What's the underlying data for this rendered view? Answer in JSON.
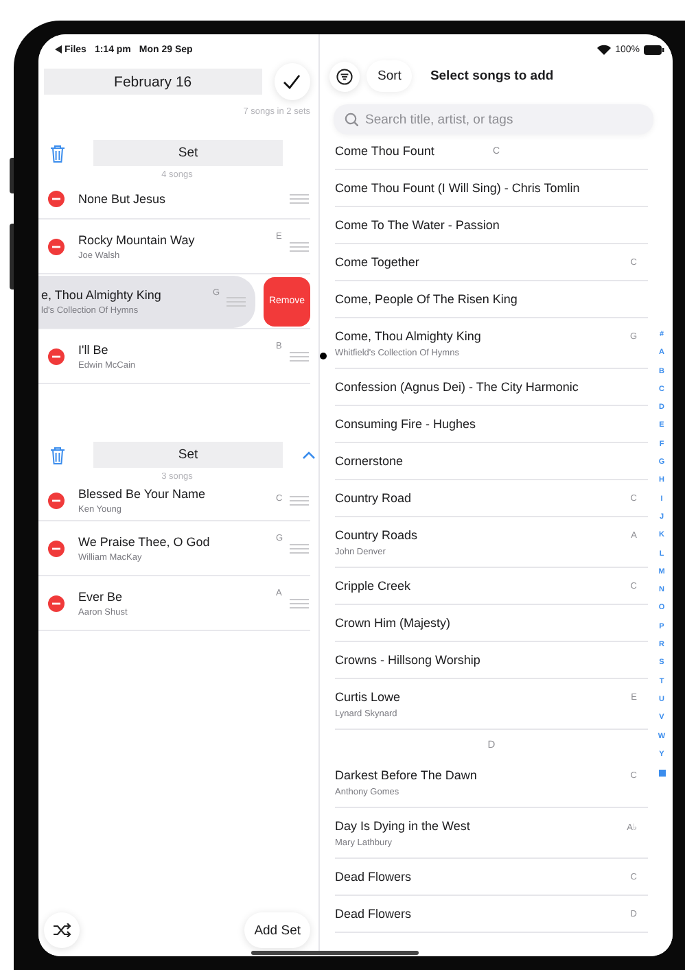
{
  "left_status": {
    "back_label": "Files",
    "time": "1:14 pm",
    "date": "Mon 29 Sep"
  },
  "setlist": {
    "title": "February 16",
    "summary": "7 songs in 2 sets"
  },
  "sets": [
    {
      "name": "Set",
      "count": "4 songs",
      "collapse_button": false,
      "songs": [
        {
          "title": "None But Jesus",
          "swiped": false
        },
        {
          "title": "Rocky Mountain Way",
          "artist": "Joe Walsh",
          "key": "E",
          "swiped": false
        },
        {
          "title": "e, Thou Almighty King",
          "artist": "ld's Collection Of Hymns",
          "key": "G",
          "swiped": true,
          "swipe_action": "Remove"
        },
        {
          "title": "I'll Be",
          "artist": "Edwin McCain",
          "key": "B",
          "swiped": false
        }
      ]
    },
    {
      "name": "Set",
      "count": "3 songs",
      "collapse_button": true,
      "songs": [
        {
          "title": "Blessed Be Your Name",
          "artist": "Ken Young",
          "key": "C",
          "swiped": false
        },
        {
          "title": "We Praise Thee, O God",
          "artist": "William MacKay",
          "key": "G",
          "swiped": false
        },
        {
          "title": "Ever Be",
          "artist": "Aaron Shust",
          "key": "A",
          "swiped": false
        }
      ]
    }
  ],
  "add_set_label": "Add Set",
  "right_status": {
    "battery": "100%"
  },
  "toolbar": {
    "sort_label": "Sort",
    "title": "Select songs to add"
  },
  "search": {
    "placeholder": "Search title, artist, or tags"
  },
  "library": [
    {
      "kind": "song",
      "title": "Come Thou Fount"
    },
    {
      "kind": "sticky_section",
      "label": "C"
    },
    {
      "kind": "song",
      "title": "Come Thou Fount (I Will Sing) - Chris Tomlin"
    },
    {
      "kind": "song",
      "title": "Come To The Water - Passion"
    },
    {
      "kind": "song",
      "title": "Come Together",
      "key": "C"
    },
    {
      "kind": "song",
      "title": "Come, People Of The Risen King"
    },
    {
      "kind": "song",
      "title": "Come, Thou Almighty King",
      "artist": "Whitfield's Collection Of Hymns",
      "key": "G"
    },
    {
      "kind": "song",
      "title": "Confession (Agnus Dei) - The City Harmonic"
    },
    {
      "kind": "song",
      "title": "Consuming Fire - Hughes"
    },
    {
      "kind": "song",
      "title": "Cornerstone"
    },
    {
      "kind": "song",
      "title": "Country Road",
      "key": "C"
    },
    {
      "kind": "song",
      "title": "Country Roads",
      "artist": "John Denver",
      "key": "A"
    },
    {
      "kind": "song",
      "title": "Cripple Creek",
      "key": "C"
    },
    {
      "kind": "song",
      "title": "Crown Him (Majesty)"
    },
    {
      "kind": "song",
      "title": "Crowns - Hillsong Worship"
    },
    {
      "kind": "song",
      "title": "Curtis Lowe",
      "artist": "Lynard Skynard",
      "key": "E"
    },
    {
      "kind": "section",
      "label": "D"
    },
    {
      "kind": "song",
      "title": "Darkest Before The Dawn",
      "artist": "Anthony Gomes",
      "key": "C"
    },
    {
      "kind": "song",
      "title": "Day Is Dying in the West",
      "artist": "Mary Lathbury",
      "key": "A♭"
    },
    {
      "kind": "song",
      "title": "Dead Flowers",
      "key": "C"
    },
    {
      "kind": "song",
      "title": "Dead Flowers",
      "key": "D"
    }
  ],
  "index_letters": [
    "#",
    "A",
    "B",
    "C",
    "D",
    "E",
    "F",
    "G",
    "H",
    "I",
    "J",
    "K",
    "L",
    "M",
    "N",
    "O",
    "P",
    "R",
    "S",
    "T",
    "U",
    "V",
    "W",
    "Y"
  ]
}
